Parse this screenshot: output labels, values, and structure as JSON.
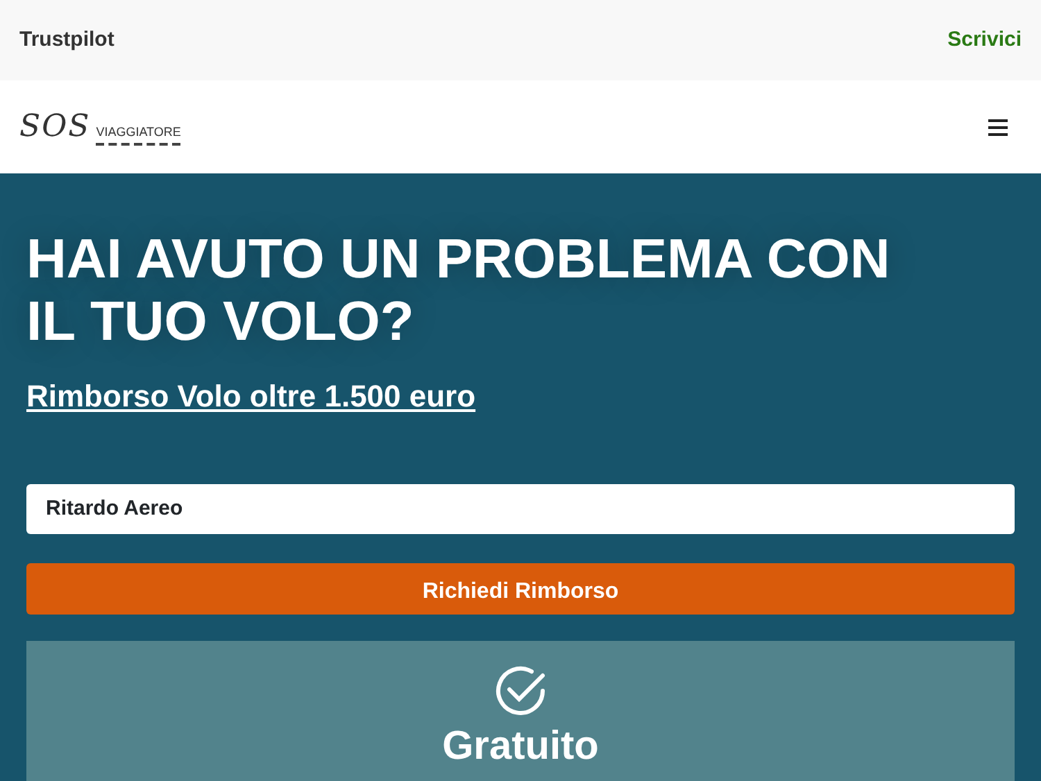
{
  "top_bar": {
    "brand": "Trustpilot",
    "link": "Scrivici"
  },
  "navbar": {
    "logo": {
      "initials": "SOS",
      "name": "VIAGGIATORE"
    }
  },
  "hero": {
    "title": "HAI AVUTO UN PROBLEMA CON IL TUO VOLO?",
    "subtitle_link": "Rimborso Volo oltre 1.500 euro",
    "select": {
      "value": "Ritardo Aereo"
    },
    "button": "Richiedi Rimborso",
    "feature_card": {
      "title": "Gratuito"
    }
  }
}
